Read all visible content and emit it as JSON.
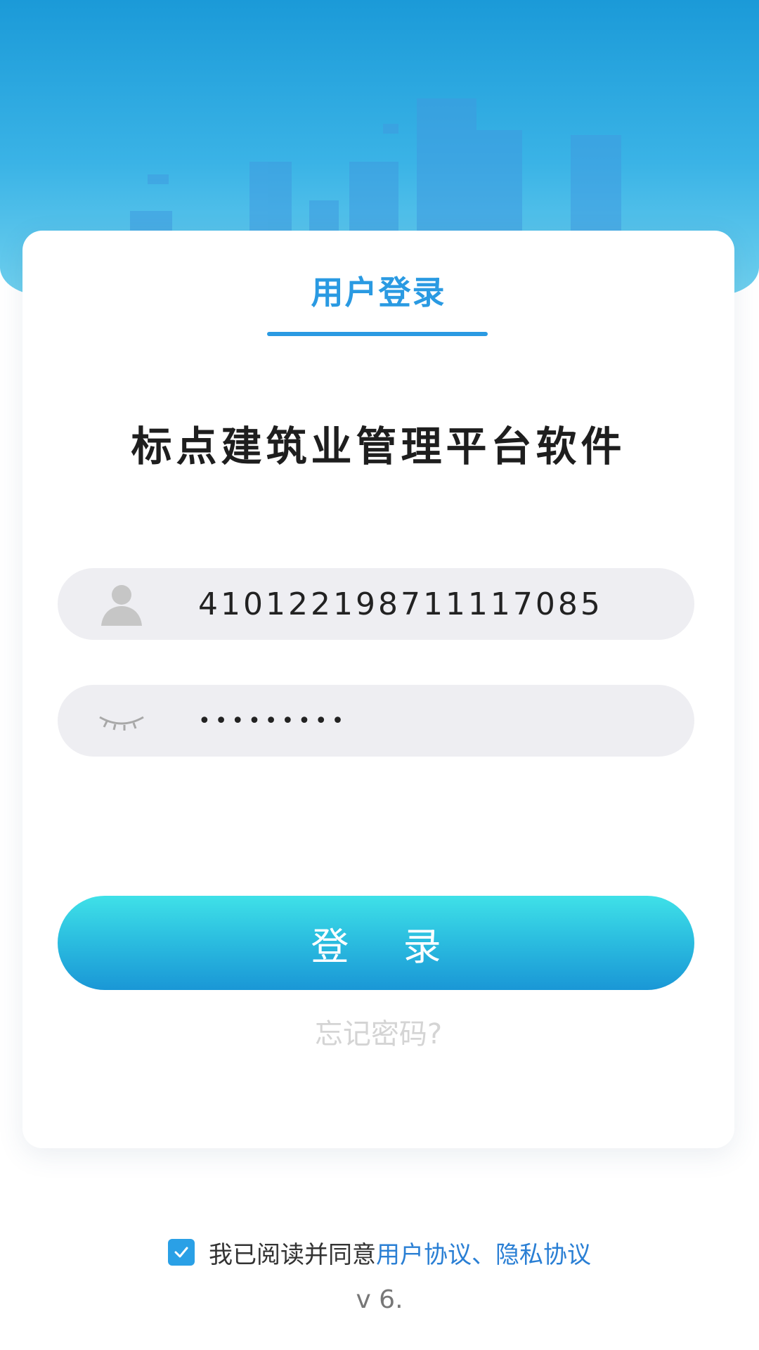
{
  "login_tab": {
    "label": "用户登录"
  },
  "app_title": "标点建筑业管理平台软件",
  "username": {
    "value": "410122198711117085"
  },
  "password": {
    "value": "•••••••••"
  },
  "login_button": {
    "label": "登 录"
  },
  "forgot_password": {
    "label": "忘记密码?"
  },
  "agreement": {
    "checked": true,
    "prefix": "我已阅读并同意",
    "user_agreement": "用户协议",
    "separator": "、",
    "privacy_agreement": "隐私协议"
  },
  "version": "v 6.",
  "icons": [
    "user-icon",
    "eye-closed-icon",
    "checkmark-icon"
  ],
  "colors": {
    "accent": "#2a9ae2",
    "button_top": "#3fe1e8",
    "button_bottom": "#1a97d6",
    "link": "#2a7fd4",
    "field_bg": "#eeeef2"
  }
}
